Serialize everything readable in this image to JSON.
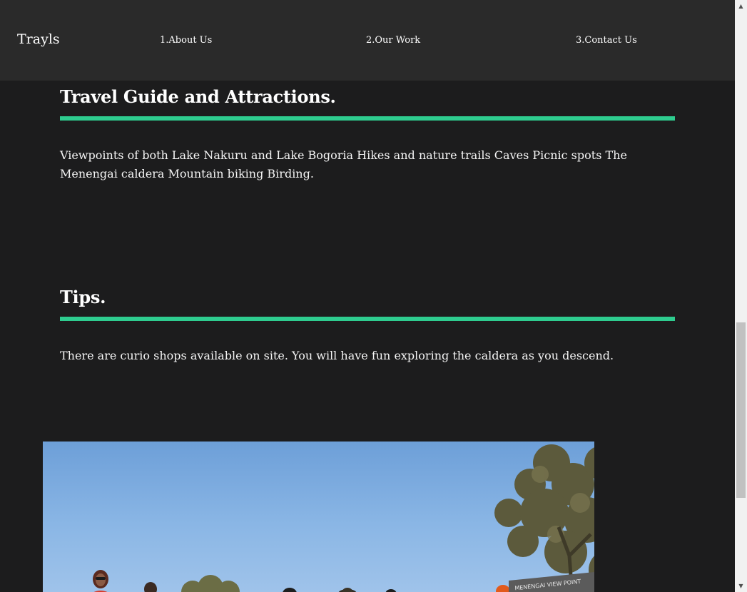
{
  "navbar": {
    "brand": "Trayls",
    "links": [
      {
        "label": "1.About Us"
      },
      {
        "label": "2.Our Work"
      },
      {
        "label": "3.Contact Us"
      }
    ]
  },
  "sections": [
    {
      "heading": "Travel Guide and Attractions.",
      "body": "Viewpoints of both Lake Nakuru and Lake Bogoria Hikes and nature trails Caves Picnic spots The Menengai caldera Mountain biking Birding."
    },
    {
      "heading": "Tips.",
      "body": "There are curio shops available on site. You will have fun exploring the caldera as you descend."
    }
  ],
  "photo": {
    "sign_text": "MENENGAI VIEW POINT"
  },
  "colors": {
    "background": "#1c1c1d",
    "navbar": "#2a2a2a",
    "accent": "#2ecc8f",
    "text": "#f5f5f5"
  },
  "scrollbar": {
    "icons": [
      "scroll-up-arrow-icon",
      "scroll-down-arrow-icon"
    ]
  }
}
